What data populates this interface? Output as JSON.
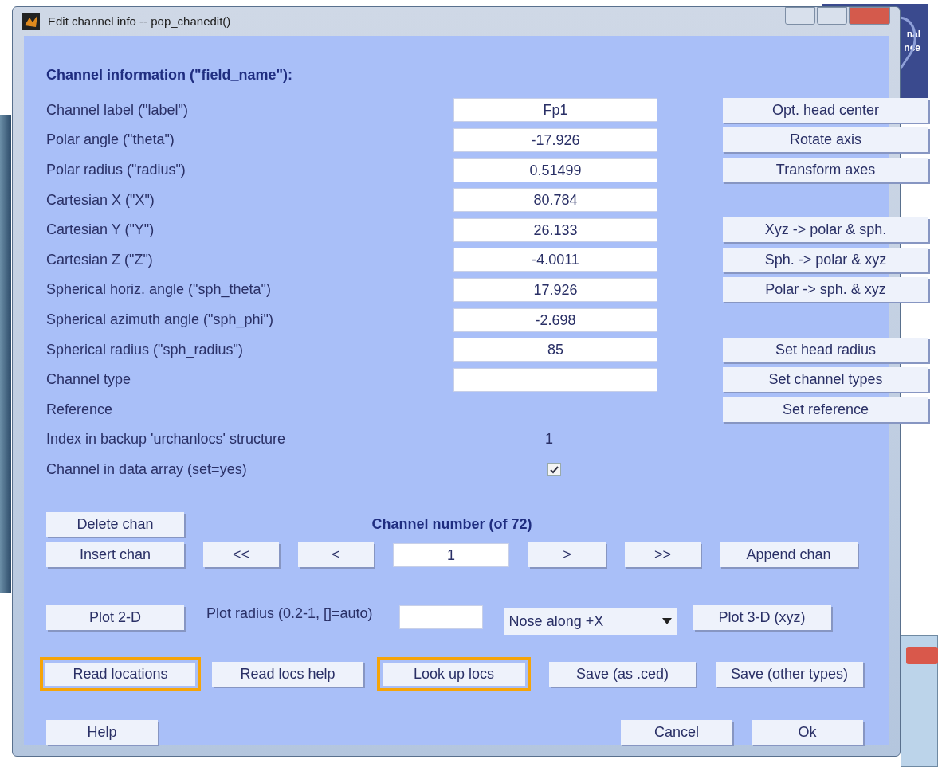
{
  "window": {
    "title": "Edit channel info -- pop_chanedit()"
  },
  "background": {
    "logo_text": [
      "nal",
      "nce"
    ]
  },
  "heading": "Channel information (\"field_name\"):",
  "rows": [
    {
      "label": "Channel label (\"label\")",
      "kind": "input",
      "value": "Fp1",
      "button": "Opt. head center"
    },
    {
      "label": "Polar angle (\"theta\")",
      "kind": "input",
      "value": "-17.926",
      "button": "Rotate axis"
    },
    {
      "label": "Polar radius (\"radius\")",
      "kind": "input",
      "value": "0.51499",
      "button": "Transform axes"
    },
    {
      "label": "Cartesian X (\"X\")",
      "kind": "input",
      "value": "80.784"
    },
    {
      "label": "Cartesian Y (\"Y\")",
      "kind": "input",
      "value": "26.133",
      "button": "Xyz -> polar & sph."
    },
    {
      "label": "Cartesian Z (\"Z\")",
      "kind": "input",
      "value": "-4.0011",
      "button": "Sph. -> polar & xyz"
    },
    {
      "label": "Spherical horiz. angle (\"sph_theta\")",
      "kind": "input",
      "value": "17.926",
      "button": "Polar -> sph. & xyz"
    },
    {
      "label": "Spherical azimuth angle (\"sph_phi\")",
      "kind": "input",
      "value": "-2.698"
    },
    {
      "label": "Spherical radius (\"sph_radius\")",
      "kind": "input",
      "value": "85",
      "button": "Set head radius"
    },
    {
      "label": "Channel type",
      "kind": "input",
      "button": "Set channel types"
    },
    {
      "label": "Reference",
      "kind": "none",
      "button": "Set reference"
    },
    {
      "label": "Index in backup 'urchanlocs' structure",
      "kind": "text",
      "value": "1"
    },
    {
      "label": "Channel in data array (set=yes)",
      "kind": "checkbox",
      "checked": true
    }
  ],
  "channel_nav": {
    "label": "Channel number (of 72)",
    "value": "1",
    "delete": "Delete chan",
    "insert": "Insert chan",
    "first": "<<",
    "prev": "<",
    "next": ">",
    "last": ">>",
    "append": "Append chan"
  },
  "plot_row": {
    "plot2d": "Plot 2-D",
    "radius_label": "Plot radius (0.2-1, []=auto)",
    "orientation": "Nose along +X",
    "plot3d": "Plot 3-D (xyz)"
  },
  "file_buttons": [
    {
      "label": "Read locations",
      "highlighted": true
    },
    {
      "label": "Read locs help",
      "highlighted": false
    },
    {
      "label": "Look up locs",
      "highlighted": true
    },
    {
      "label": "Save (as .ced)",
      "highlighted": false
    },
    {
      "label": "Save (other types)",
      "highlighted": false
    }
  ],
  "footer": {
    "help": "Help",
    "cancel": "Cancel",
    "ok": "Ok"
  }
}
